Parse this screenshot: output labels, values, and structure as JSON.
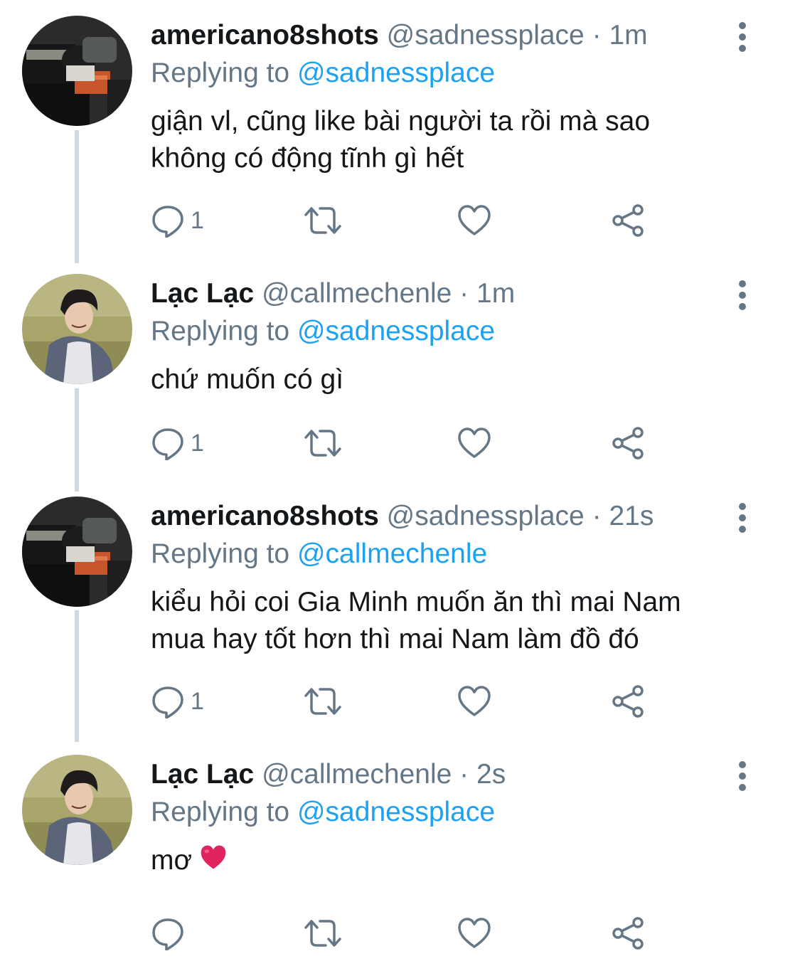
{
  "tweets": [
    {
      "name": "americano8shots",
      "handle": "@sadnessplace",
      "dot": "·",
      "time": "1m",
      "replying_prefix": "Replying to",
      "replying_to": "@sadnessplace",
      "lines": [
        "giận vl, cũng like bài người ta rồi mà sao",
        "không có động tĩnh gì hết"
      ],
      "reply_count": "1",
      "avatar": "guitar-amp-photo"
    },
    {
      "name": "Lạc Lạc",
      "handle": "@callmechenle",
      "dot": "·",
      "time": "1m",
      "replying_prefix": "Replying to",
      "replying_to": "@sadnessplace",
      "lines": [
        "chứ muốn có gì"
      ],
      "reply_count": "1",
      "avatar": "person-on-grass-photo"
    },
    {
      "name": "americano8shots",
      "handle": "@sadnessplace",
      "dot": "·",
      "time": "21s",
      "replying_prefix": "Replying to",
      "replying_to": "@callmechenle",
      "lines": [
        "kiểu hỏi coi Gia Minh muốn ăn thì mai Nam",
        "mua hay tốt hơn thì mai Nam làm đồ đó"
      ],
      "reply_count": "1",
      "avatar": "guitar-amp-photo"
    },
    {
      "name": "Lạc Lạc",
      "handle": "@callmechenle",
      "dot": "·",
      "time": "2s",
      "replying_prefix": "Replying to",
      "replying_to": "@sadnessplace",
      "lines": [
        "mơ"
      ],
      "reply_count": "",
      "emoji": "red-heart-emoji",
      "avatar": "person-on-grass-photo"
    }
  ],
  "icons": [
    "reply-icon",
    "retweet-icon",
    "like-icon",
    "share-icon",
    "more-options-icon"
  ],
  "colors": {
    "text": "#14171a",
    "secondary": "#657786",
    "link": "#1da1f2",
    "thread_line": "#cfd9de",
    "heart_emoji": "#e0245e"
  }
}
